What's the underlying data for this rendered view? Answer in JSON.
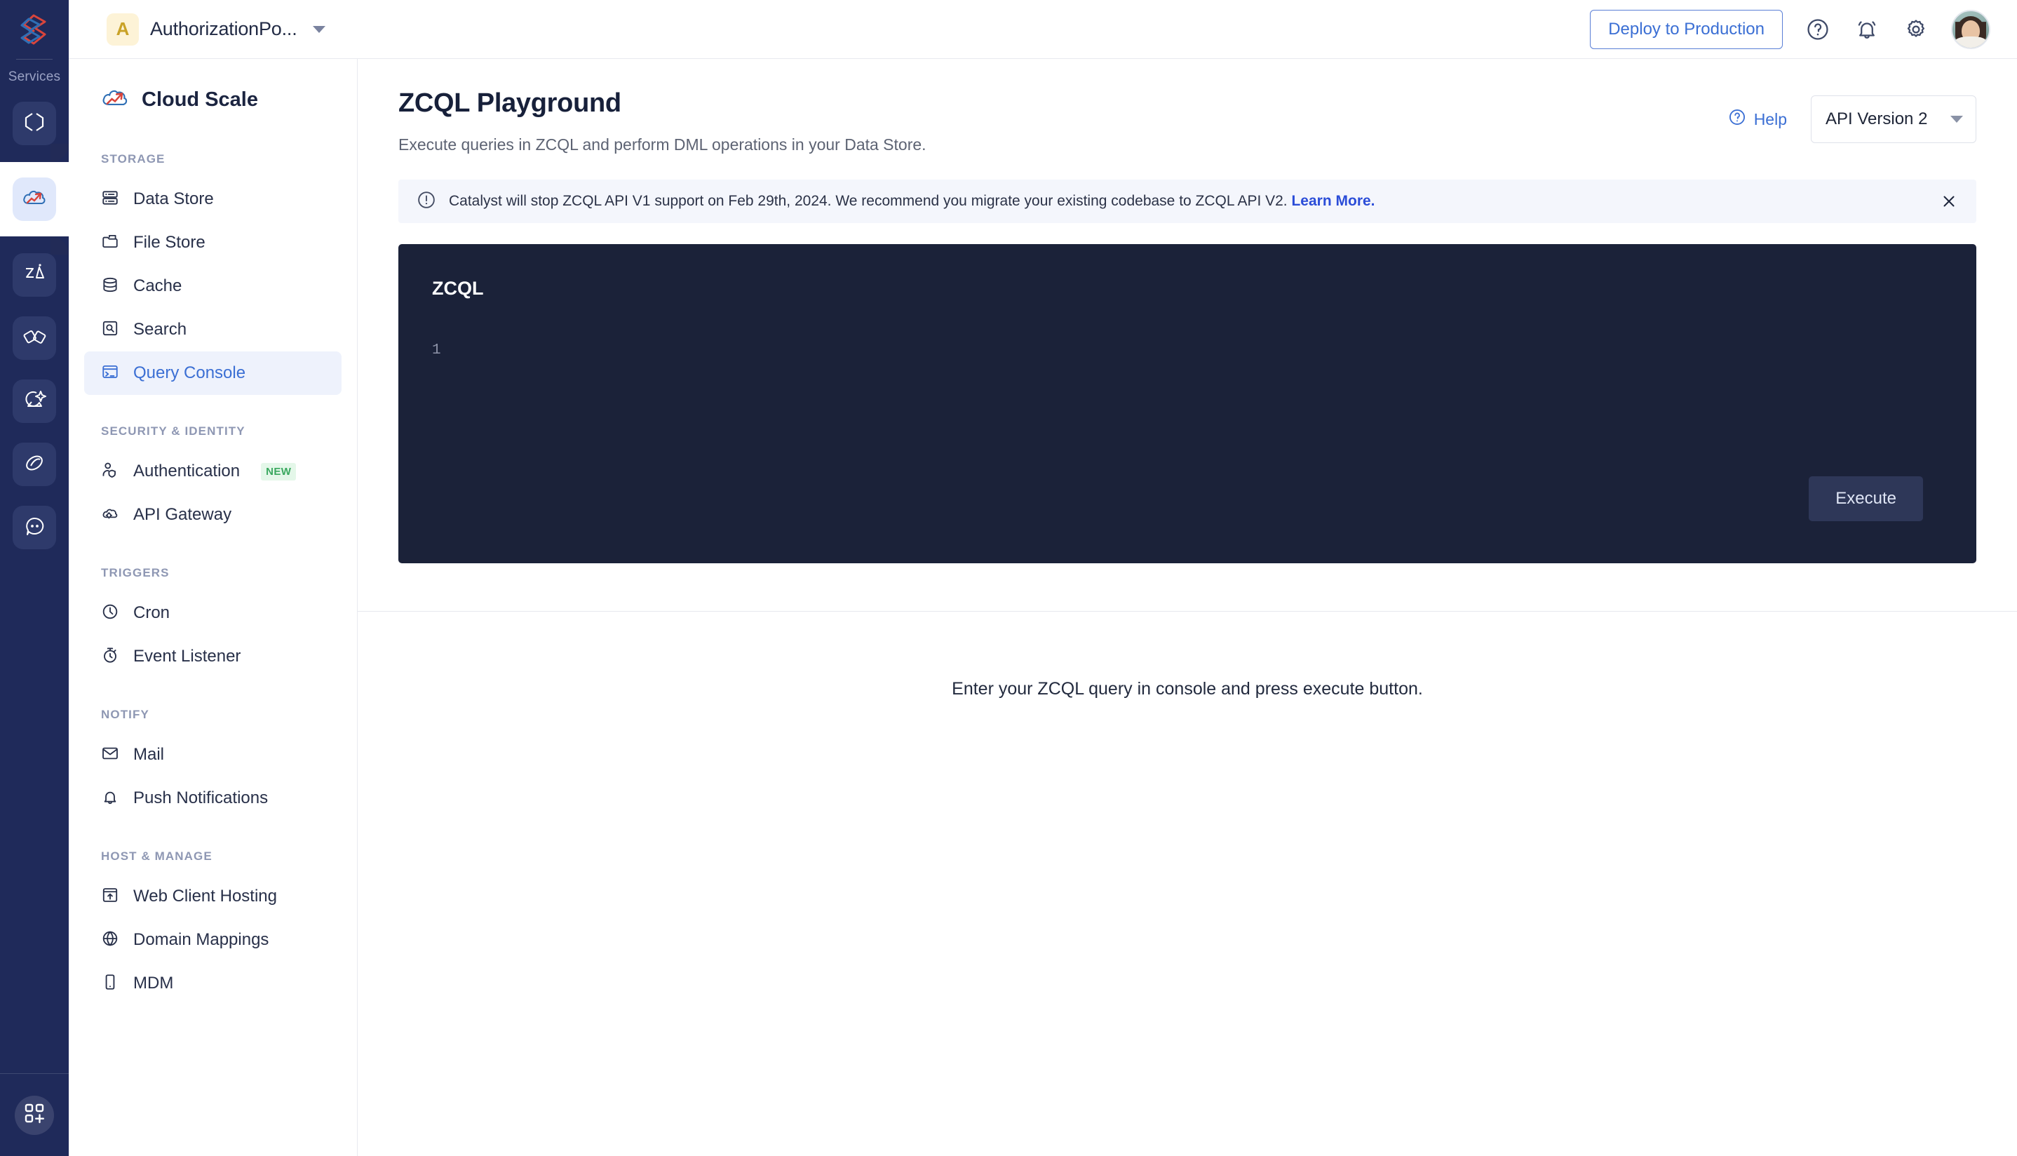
{
  "rail": {
    "services_label": "Services",
    "logo_name": "catalyst-logo-icon",
    "items": [
      {
        "name": "code-brackets-icon",
        "active": false
      },
      {
        "name": "cloud-scale-icon",
        "active": true
      },
      {
        "name": "zia-icon",
        "active": false
      },
      {
        "name": "app-connect-icon",
        "active": false
      },
      {
        "name": "quickml-icon",
        "active": false
      },
      {
        "name": "signals-icon",
        "active": false
      },
      {
        "name": "chat-bot-icon",
        "active": false
      }
    ],
    "add_button": "add-service-button"
  },
  "topbar": {
    "app_initial": "A",
    "app_name": "AuthorizationPo...",
    "deploy_label": "Deploy to Production",
    "help_icon": "help-circle-icon",
    "notifications_icon": "bell-icon",
    "settings_icon": "gear-icon",
    "avatar": "user-avatar"
  },
  "sidebar": {
    "service_name": "Cloud Scale",
    "groups": [
      {
        "label": "STORAGE",
        "items": [
          {
            "label": "Data Store",
            "icon": "server-icon",
            "active": false
          },
          {
            "label": "File Store",
            "icon": "folder-icon",
            "active": false
          },
          {
            "label": "Cache",
            "icon": "database-icon",
            "active": false
          },
          {
            "label": "Search",
            "icon": "search-box-icon",
            "active": false
          },
          {
            "label": "Query Console",
            "icon": "terminal-icon",
            "active": true
          }
        ]
      },
      {
        "label": "SECURITY & IDENTITY",
        "items": [
          {
            "label": "Authentication",
            "icon": "user-shield-icon",
            "active": false,
            "badge": "NEW"
          },
          {
            "label": "API Gateway",
            "icon": "cloud-gear-icon",
            "active": false
          }
        ]
      },
      {
        "label": "TRIGGERS",
        "items": [
          {
            "label": "Cron",
            "icon": "clock-icon",
            "active": false
          },
          {
            "label": "Event Listener",
            "icon": "stopwatch-icon",
            "active": false
          }
        ]
      },
      {
        "label": "NOTIFY",
        "items": [
          {
            "label": "Mail",
            "icon": "envelope-icon",
            "active": false
          },
          {
            "label": "Push Notifications",
            "icon": "bell-icon",
            "active": false
          }
        ]
      },
      {
        "label": "HOST & MANAGE",
        "items": [
          {
            "label": "Web Client Hosting",
            "icon": "upload-window-icon",
            "active": false
          },
          {
            "label": "Domain Mappings",
            "icon": "globe-icon",
            "active": false
          },
          {
            "label": "MDM",
            "icon": "mobile-device-icon",
            "active": false
          }
        ]
      }
    ]
  },
  "page": {
    "title": "ZCQL Playground",
    "subtitle": "Execute queries in ZCQL and perform DML operations in your Data Store.",
    "help_label": "Help",
    "api_version": "API Version 2"
  },
  "banner": {
    "icon": "info-circle-icon",
    "text": "Catalyst will stop ZCQL API V1 support on Feb 29th, 2024. We recommend you migrate your existing codebase to ZCQL API V2. ",
    "link_label": "Learn More.",
    "close_icon": "close-icon"
  },
  "editor": {
    "label": "ZCQL",
    "line_number": "1",
    "code": "",
    "execute_label": "Execute"
  },
  "result": {
    "empty_message": "Enter your ZCQL query in console and press execute button."
  },
  "colors": {
    "accent": "#3b6fd4",
    "rail_bg": "#222b57",
    "editor_bg": "#1b2239",
    "banner_bg": "#f4f6fc",
    "badge_green": "#3aa85f",
    "badge_gold": "#c9a227"
  }
}
